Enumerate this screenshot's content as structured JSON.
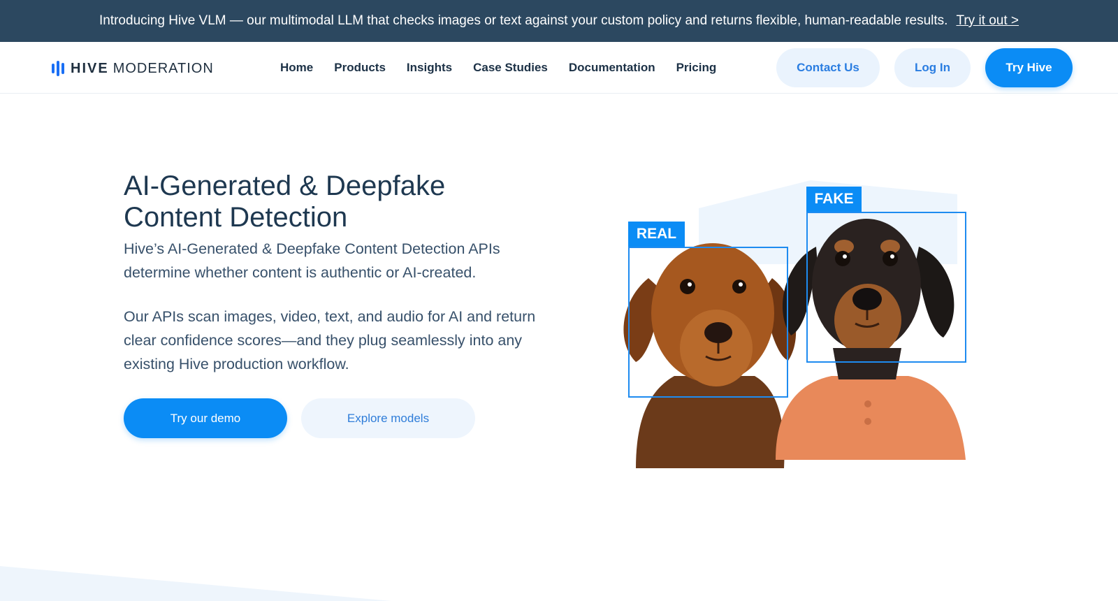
{
  "announcement": {
    "text": "Introducing Hive VLM — our multimodal LLM that checks images or text against your custom policy and returns flexible, human-readable results.",
    "link_label": "Try it out >"
  },
  "nav": {
    "logo_bold": "HIVE",
    "logo_light": "MODERATION",
    "links": [
      "Home",
      "Products",
      "Insights",
      "Case Studies",
      "Documentation",
      "Pricing"
    ],
    "contact_label": "Contact Us",
    "login_label": "Log In",
    "try_label": "Try Hive"
  },
  "hero": {
    "title": "AI-Generated & Deepfake Content Detection",
    "subtitle": "Hive’s AI-Generated & Deepfake Content Detection APIs determine whether content is authentic or AI-created.",
    "body": "Our APIs scan images, video, text, and audio for AI and return clear confidence scores—and they plug seamlessly into any existing Hive production workflow.",
    "demo_label": "Try our demo",
    "explore_label": "Explore models"
  },
  "illustration": {
    "real_tag": "REAL",
    "fake_tag": "FAKE",
    "accent_color": "#0b8cf5"
  },
  "colors": {
    "announce_bg": "#2c4860",
    "primary": "#0b8cf5",
    "soft_button": "#eaf3fd",
    "heading": "#1e3850"
  }
}
